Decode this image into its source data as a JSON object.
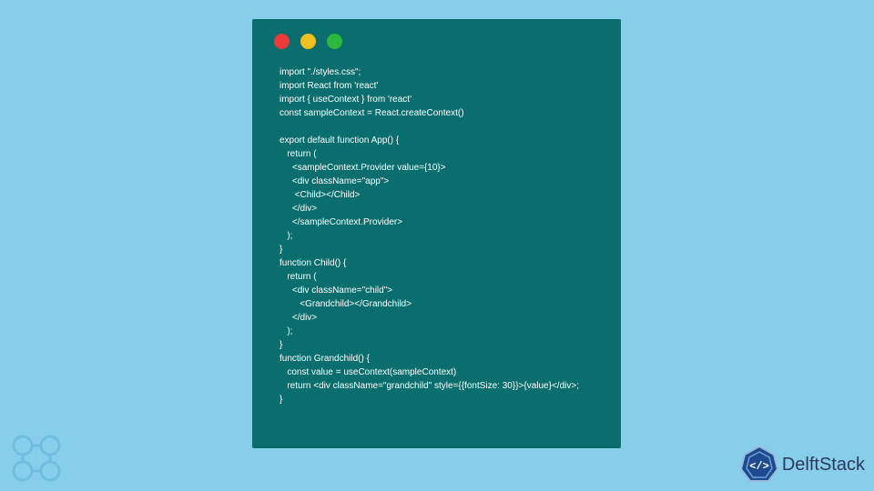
{
  "window": {
    "dots": [
      "red",
      "yellow",
      "green"
    ]
  },
  "code": {
    "lines": [
      "import \"./styles.css\";",
      "import React from 'react'",
      "import { useContext } from 'react'",
      "const sampleContext = React.createContext()",
      "",
      "export default function App() {",
      "   return (",
      "     <sampleContext.Provider value={10}>",
      "     <div className=\"app\">",
      "      <Child></Child>",
      "     </div>",
      "     </sampleContext.Provider>",
      "   );",
      "}",
      "function Child() {",
      "   return (",
      "     <div className=\"child\">",
      "        <Grandchild></Grandchild>",
      "     </div>",
      "   );",
      "}",
      "function Grandchild() {",
      "   const value = useContext(sampleContext)",
      "   return <div className=\"grandchild\" style={{fontSize: 30}}>{value}</div>;",
      "}"
    ]
  },
  "watermark": {
    "text": "DelftStack"
  }
}
